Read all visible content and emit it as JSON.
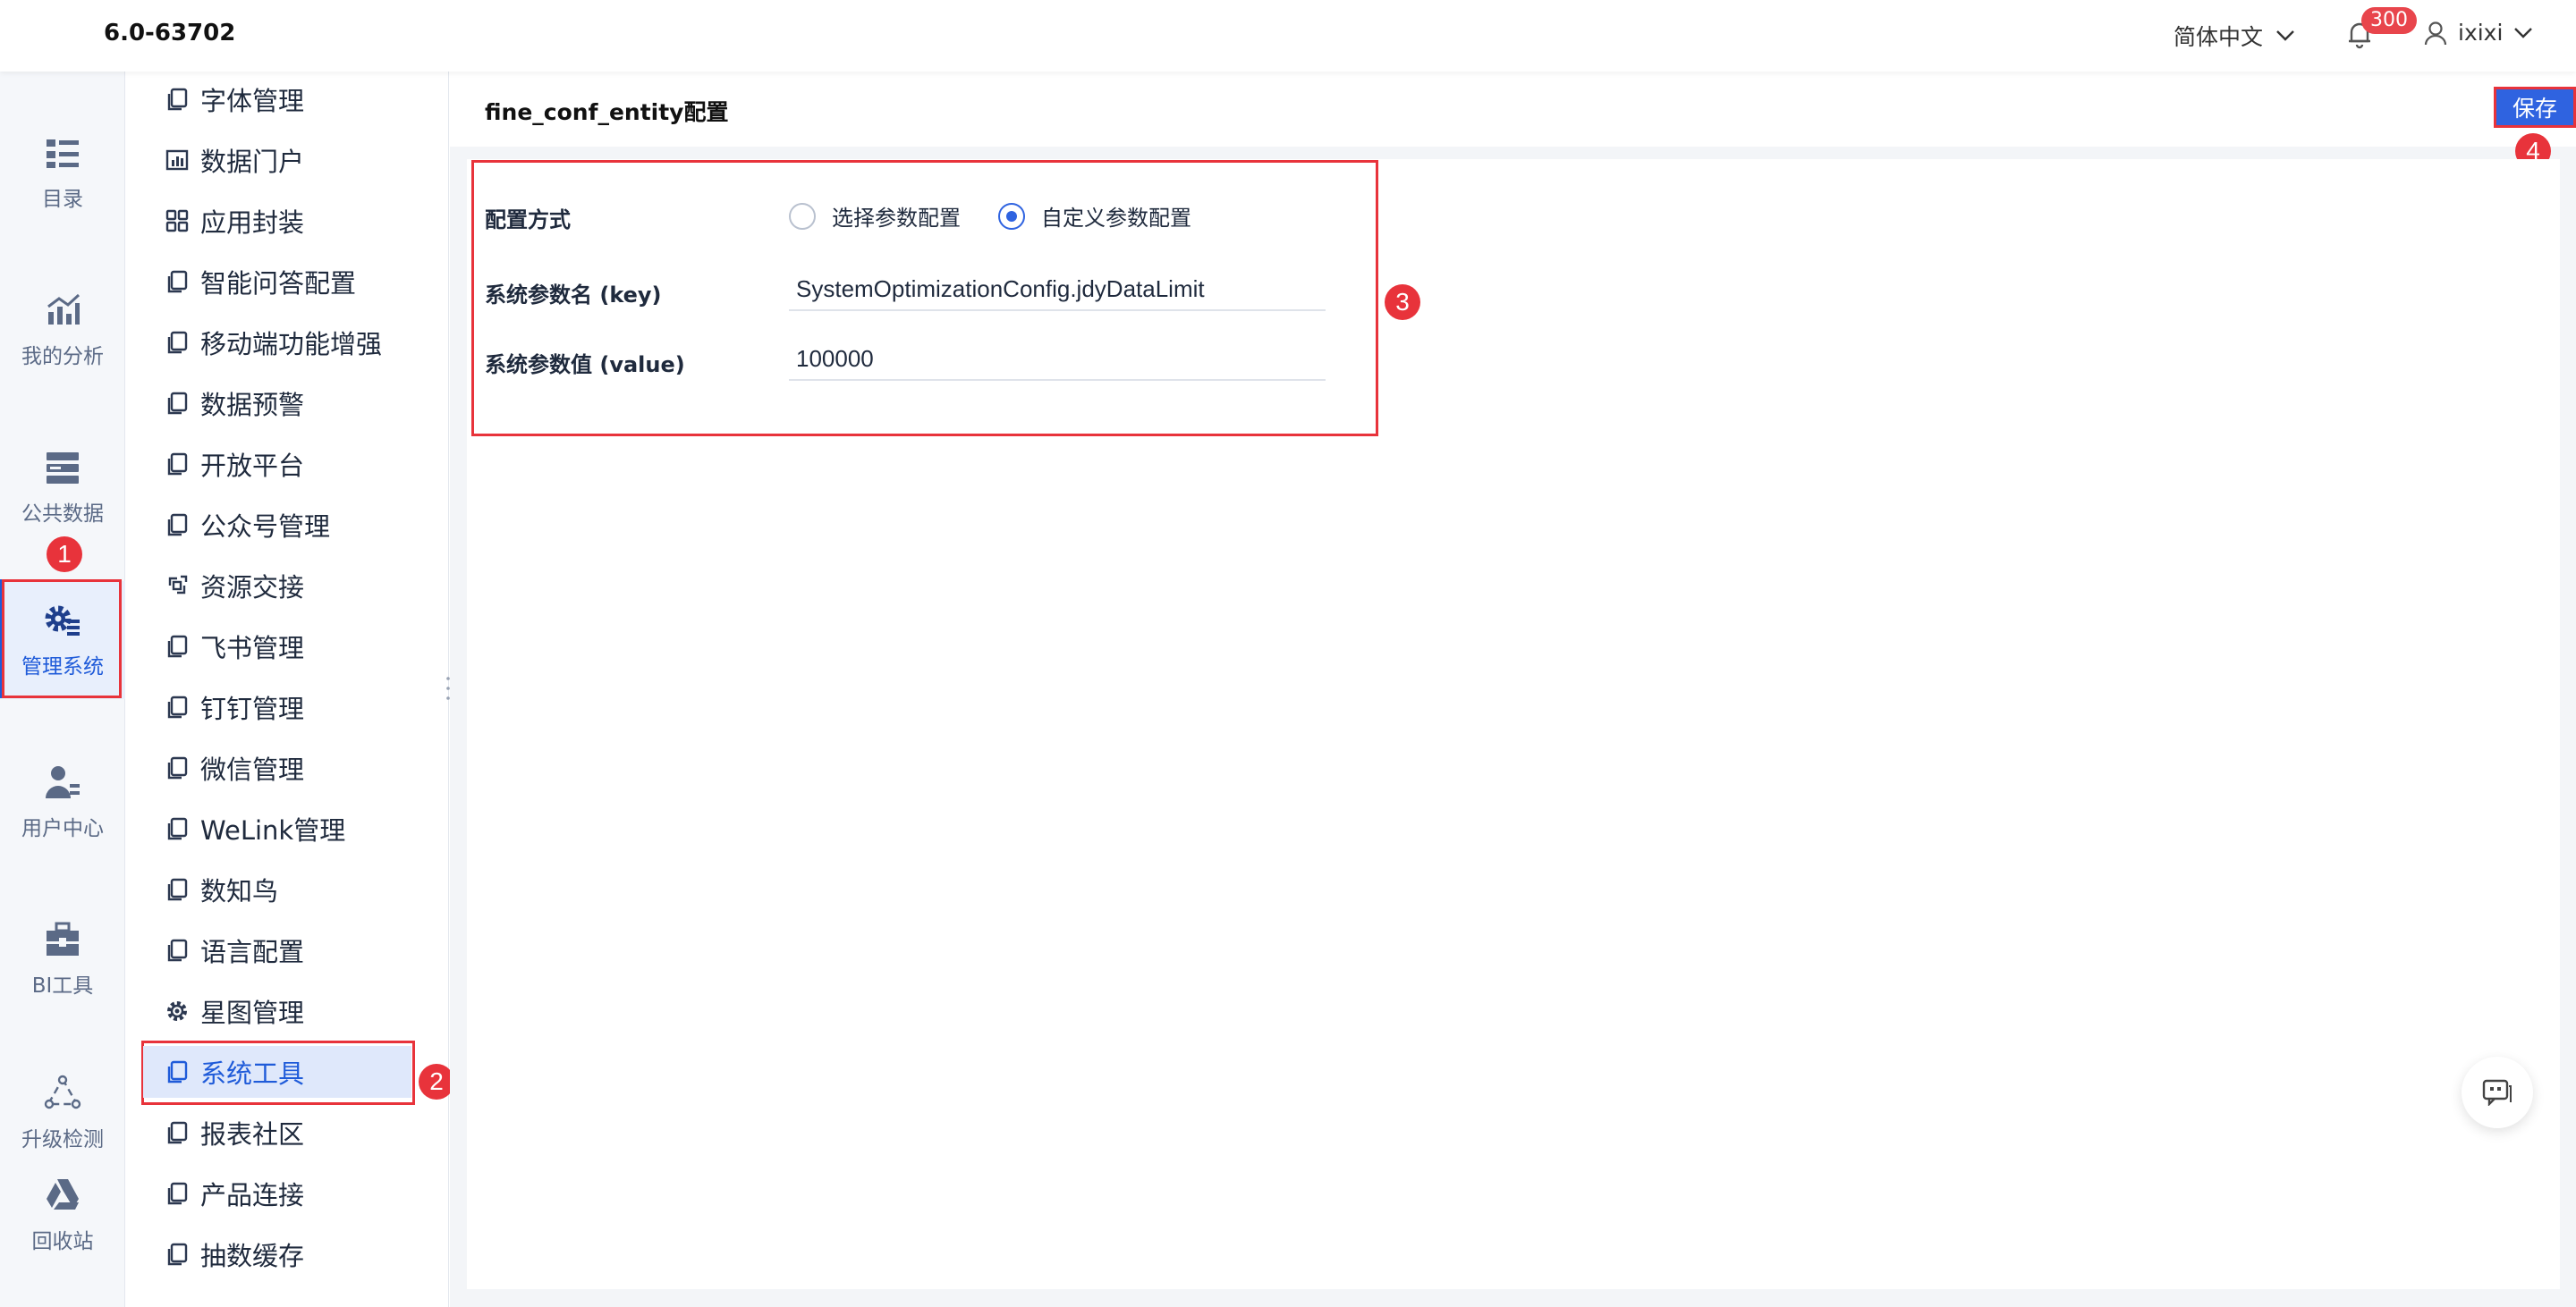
{
  "topbar": {
    "version": "6.0-63702",
    "language": "简体中文",
    "notification_count": "300",
    "username": "ixixi"
  },
  "rail": {
    "items": [
      {
        "label": "目录",
        "icon": "catalog-icon"
      },
      {
        "label": "我的分析",
        "icon": "analysis-chart-icon"
      },
      {
        "label": "公共数据",
        "icon": "public-data-icon"
      },
      {
        "label": "管理系统",
        "icon": "gear-list-icon"
      },
      {
        "label": "用户中心",
        "icon": "user-center-icon"
      },
      {
        "label": "BI工具",
        "icon": "toolbox-icon"
      },
      {
        "label": "升级检测",
        "icon": "upgrade-detect-icon"
      },
      {
        "label": "回收站",
        "icon": "recycle-bin-icon"
      }
    ],
    "active_index": 3
  },
  "menu": {
    "items": [
      {
        "label": "字体管理",
        "icon": "copy-icon"
      },
      {
        "label": "数据门户",
        "icon": "data-portal-icon"
      },
      {
        "label": "应用封装",
        "icon": "app-grid-icon"
      },
      {
        "label": "智能问答配置",
        "icon": "copy-icon"
      },
      {
        "label": "移动端功能增强",
        "icon": "copy-icon"
      },
      {
        "label": "数据预警",
        "icon": "copy-icon"
      },
      {
        "label": "开放平台",
        "icon": "copy-icon"
      },
      {
        "label": "公众号管理",
        "icon": "copy-icon"
      },
      {
        "label": "资源交接",
        "icon": "resource-handover-icon"
      },
      {
        "label": "飞书管理",
        "icon": "copy-icon"
      },
      {
        "label": "钉钉管理",
        "icon": "copy-icon"
      },
      {
        "label": "微信管理",
        "icon": "copy-icon"
      },
      {
        "label": "WeLink管理",
        "icon": "copy-icon"
      },
      {
        "label": "数知鸟",
        "icon": "copy-icon"
      },
      {
        "label": "语言配置",
        "icon": "copy-icon"
      },
      {
        "label": "星图管理",
        "icon": "gear-icon"
      },
      {
        "label": "系统工具",
        "icon": "copy-icon"
      },
      {
        "label": "报表社区",
        "icon": "copy-icon"
      },
      {
        "label": "产品连接",
        "icon": "copy-icon"
      },
      {
        "label": "抽数缓存",
        "icon": "copy-icon"
      }
    ],
    "active_index": 16
  },
  "main": {
    "title": "fine_conf_entity配置",
    "save_label": "保存",
    "form": {
      "mode_label": "配置方式",
      "mode_options": [
        "选择参数配置",
        "自定义参数配置"
      ],
      "mode_selected": "自定义参数配置",
      "key_label": "系统参数名 (key)",
      "key_value": "SystemOptimizationConfig.jdyDataLimit",
      "value_label": "系统参数值 (value)",
      "value_value": "100000"
    }
  },
  "annotations": [
    "1",
    "2",
    "3",
    "4"
  ],
  "colors": {
    "accent": "#2f63e0",
    "highlight": "#e8333b",
    "rail_background": "#f5f7fa"
  }
}
